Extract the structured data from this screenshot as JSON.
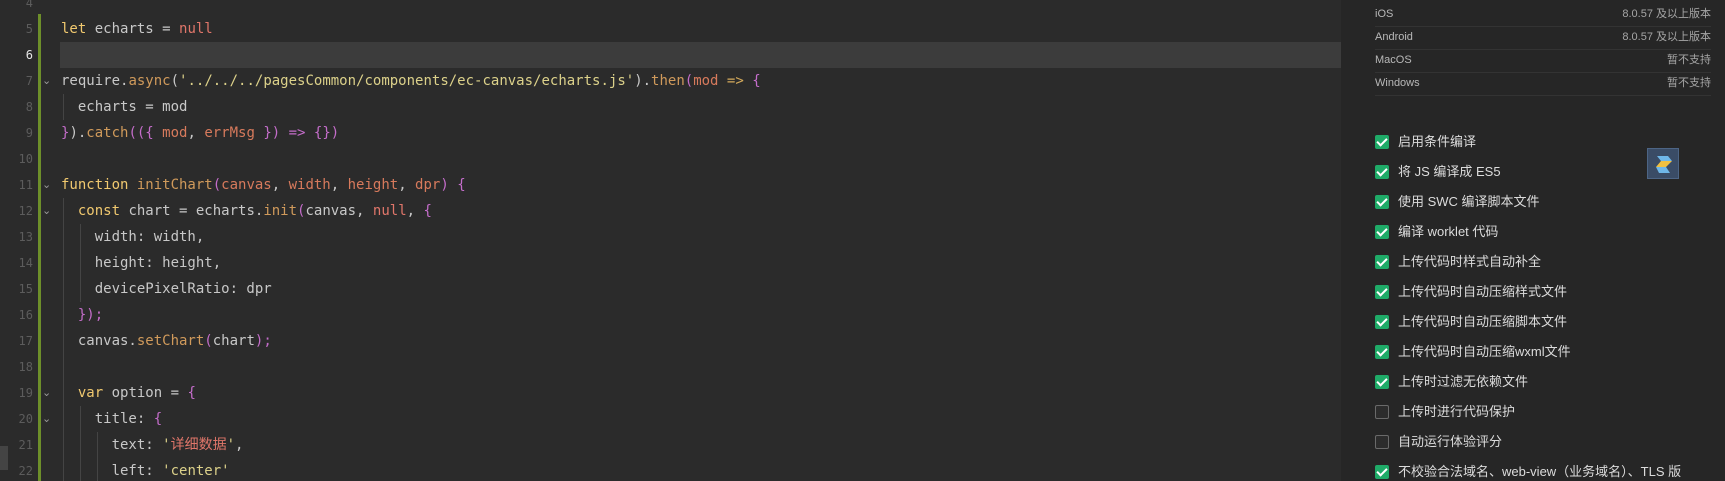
{
  "editor": {
    "line_numbers": [
      "4",
      "5",
      "6",
      "7",
      "8",
      "9",
      "10",
      "11",
      "12",
      "13",
      "14",
      "15",
      "16",
      "17",
      "18",
      "19",
      "20",
      "21",
      "22"
    ],
    "active_line": "6",
    "lines": [
      [],
      [
        [
          "kw",
          "let"
        ],
        [
          "pl",
          " echarts = "
        ],
        [
          "nl",
          "null"
        ]
      ],
      [],
      [
        [
          "pl",
          "require."
        ],
        [
          "fn",
          "async"
        ],
        [
          "pl",
          "("
        ],
        [
          "str",
          "'../../../pagesCommon/components/ec-canvas/echarts.js'"
        ],
        [
          "pl",
          ")."
        ],
        [
          "fn",
          "then"
        ],
        [
          "par",
          "("
        ],
        [
          "pm",
          "mod"
        ],
        [
          "op",
          " => "
        ],
        [
          "par",
          "{"
        ]
      ],
      [
        [
          "pl",
          "  echarts = mod"
        ]
      ],
      [
        [
          "par",
          "}"
        ],
        [
          "pl",
          ")."
        ],
        [
          "fn",
          "catch"
        ],
        [
          "par",
          "(({ "
        ],
        [
          "pm",
          "mod"
        ],
        [
          "pl",
          ", "
        ],
        [
          "pm",
          "errMsg"
        ],
        [
          "par",
          " }) => {})"
        ]
      ],
      [],
      [
        [
          "kw",
          "function "
        ],
        [
          "fn",
          "initChart"
        ],
        [
          "par",
          "("
        ],
        [
          "pm",
          "canvas"
        ],
        [
          "pl",
          ", "
        ],
        [
          "pm",
          "width"
        ],
        [
          "pl",
          ", "
        ],
        [
          "pm",
          "height"
        ],
        [
          "pl",
          ", "
        ],
        [
          "pm",
          "dpr"
        ],
        [
          "par",
          ") {"
        ]
      ],
      [
        [
          "pl",
          "  "
        ],
        [
          "kw",
          "const"
        ],
        [
          "pl",
          " chart = echarts."
        ],
        [
          "fn",
          "init"
        ],
        [
          "par",
          "("
        ],
        [
          "pl",
          "canvas, "
        ],
        [
          "nl",
          "null"
        ],
        [
          "pl",
          ", "
        ],
        [
          "par",
          "{"
        ]
      ],
      [
        [
          "pl",
          "    width: width,"
        ]
      ],
      [
        [
          "pl",
          "    height: height,"
        ]
      ],
      [
        [
          "pl",
          "    devicePixelRatio: dpr"
        ]
      ],
      [
        [
          "pl",
          "  "
        ],
        [
          "par",
          "});"
        ]
      ],
      [
        [
          "pl",
          "  canvas."
        ],
        [
          "fn",
          "setChart"
        ],
        [
          "par",
          "("
        ],
        [
          "pl",
          "chart"
        ],
        [
          "par",
          ");"
        ]
      ],
      [],
      [
        [
          "pl",
          "  "
        ],
        [
          "kw",
          "var"
        ],
        [
          "pl",
          " option = "
        ],
        [
          "par",
          "{"
        ]
      ],
      [
        [
          "pl",
          "    title: "
        ],
        [
          "par",
          "{"
        ]
      ],
      [
        [
          "pl",
          "      text: "
        ],
        [
          "str",
          "'"
        ],
        [
          "nl",
          "详细数据"
        ],
        [
          "str",
          "'"
        ],
        [
          "pl",
          ","
        ]
      ],
      [
        [
          "pl",
          "      left: "
        ],
        [
          "str",
          "'center'"
        ]
      ]
    ]
  },
  "platforms": [
    {
      "name": "iOS",
      "version": "8.0.57 及以上版本"
    },
    {
      "name": "Android",
      "version": "8.0.57 及以上版本"
    },
    {
      "name": "MacOS",
      "version": "暂不支持"
    },
    {
      "name": "Windows",
      "version": "暂不支持"
    }
  ],
  "options": [
    {
      "label": "启用条件编译",
      "checked": true
    },
    {
      "label": "将 JS 编译成 ES5",
      "checked": true
    },
    {
      "label": "使用 SWC 编译脚本文件",
      "checked": true
    },
    {
      "label": "编译 worklet 代码",
      "checked": true
    },
    {
      "label": "上传代码时样式自动补全",
      "checked": true
    },
    {
      "label": "上传代码时自动压缩样式文件",
      "checked": true
    },
    {
      "label": "上传代码时自动压缩脚本文件",
      "checked": true
    },
    {
      "label": "上传代码时自动压缩wxml文件",
      "checked": true
    },
    {
      "label": "上传时过滤无依赖文件",
      "checked": true
    },
    {
      "label": "上传时进行代码保护",
      "checked": false
    },
    {
      "label": "自动运行体验评分",
      "checked": false
    },
    {
      "label": "不校验合法域名、web-view（业务域名）、TLS 版",
      "checked": true
    }
  ],
  "colors": {
    "checkbox_on": "#1fab68",
    "change_bar": "#6d8f2a"
  },
  "icons": {
    "side_logo": "plugin-logo-icon",
    "fold": "chevron-down-icon"
  }
}
